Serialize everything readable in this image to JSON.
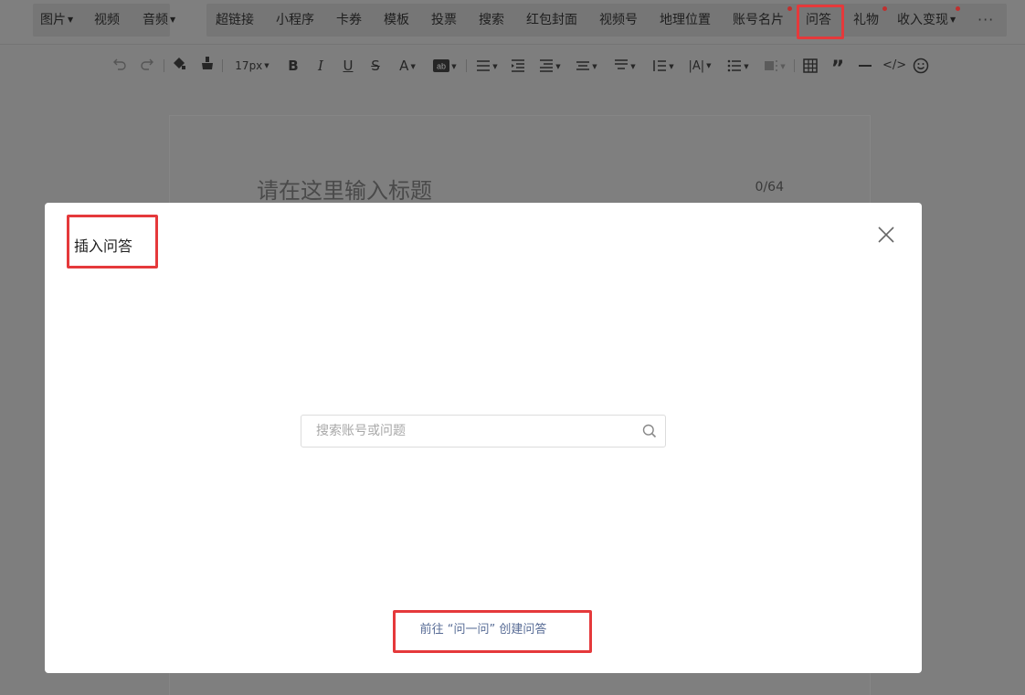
{
  "menubar": {
    "items": [
      {
        "label": "图片",
        "dropdown": true
      },
      {
        "label": "视频"
      },
      {
        "label": "音频",
        "dropdown": true
      },
      {
        "label": "超链接"
      },
      {
        "label": "小程序"
      },
      {
        "label": "卡券"
      },
      {
        "label": "模板"
      },
      {
        "label": "投票"
      },
      {
        "label": "搜索"
      },
      {
        "label": "红包封面"
      },
      {
        "label": "视频号"
      },
      {
        "label": "地理位置"
      },
      {
        "label": "账号名片",
        "badge": true
      },
      {
        "label": "问答",
        "highlighted": true
      },
      {
        "label": "礼物",
        "badge": true
      },
      {
        "label": "收入变现",
        "dropdown": true,
        "badge": true
      }
    ],
    "more_icon": "more-horizontal-icon",
    "badge_color": "#c0302e",
    "highlight_color": "#e5393b"
  },
  "toolbar": {
    "font_size": "17px",
    "icons": [
      "undo-icon",
      "redo-icon",
      "format-painter-icon",
      "clear-format-icon",
      "font-size-select",
      "bold-icon",
      "italic-icon",
      "underline-icon",
      "strikethrough-icon",
      "font-color-icon",
      "background-color-icon",
      "align-icon",
      "indent-icon",
      "first-line-indent-icon",
      "paragraph-spacing-before-icon",
      "paragraph-spacing-after-icon",
      "line-height-icon",
      "letter-spacing-icon",
      "list-icon",
      "border-shading-icon",
      "table-icon",
      "quote-icon",
      "divider-icon",
      "code-icon",
      "emoji-icon"
    ]
  },
  "editor": {
    "title_placeholder": "请在这里输入标题",
    "title_counter": "0/64"
  },
  "modal": {
    "title": "插入问答",
    "search_placeholder": "搜索账号或问题",
    "search_value": "",
    "create_link": "前往 “问一问” 创建问答",
    "link_color": "#576b95"
  }
}
